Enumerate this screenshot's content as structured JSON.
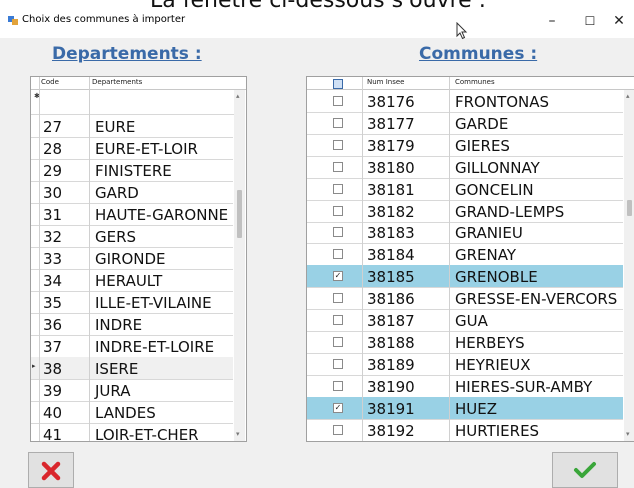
{
  "overlay_text": "La fenêtre ci-dessous s'ouvre :",
  "window": {
    "title": "Choix des communes à importer",
    "minimize": "–",
    "maximize": "☐",
    "close": "✕"
  },
  "departements": {
    "section_title": "Departements :",
    "headers": {
      "code": "Code",
      "name": "Departements"
    },
    "rows": [
      {
        "code": "27",
        "name": "EURE"
      },
      {
        "code": "28",
        "name": "EURE-ET-LOIR"
      },
      {
        "code": "29",
        "name": "FINISTERE"
      },
      {
        "code": "30",
        "name": "GARD"
      },
      {
        "code": "31",
        "name": "HAUTE-GARONNE"
      },
      {
        "code": "32",
        "name": "GERS"
      },
      {
        "code": "33",
        "name": "GIRONDE"
      },
      {
        "code": "34",
        "name": "HERAULT"
      },
      {
        "code": "35",
        "name": "ILLE-ET-VILAINE"
      },
      {
        "code": "36",
        "name": "INDRE"
      },
      {
        "code": "37",
        "name": "INDRE-ET-LOIRE"
      },
      {
        "code": "38",
        "name": "ISERE"
      },
      {
        "code": "39",
        "name": "JURA"
      },
      {
        "code": "40",
        "name": "LANDES"
      },
      {
        "code": "41",
        "name": "LOIR-ET-CHER"
      }
    ]
  },
  "communes": {
    "section_title": "Communes :",
    "headers": {
      "insee": "Num Insee",
      "name": "Communes"
    },
    "rows": [
      {
        "insee": "38176",
        "name": "FRONTONAS",
        "checked": false
      },
      {
        "insee": "38177",
        "name": "GARDE",
        "checked": false
      },
      {
        "insee": "38179",
        "name": "GIERES",
        "checked": false
      },
      {
        "insee": "38180",
        "name": "GILLONNAY",
        "checked": false
      },
      {
        "insee": "38181",
        "name": "GONCELIN",
        "checked": false
      },
      {
        "insee": "38182",
        "name": "GRAND-LEMPS",
        "checked": false
      },
      {
        "insee": "38183",
        "name": "GRANIEU",
        "checked": false
      },
      {
        "insee": "38184",
        "name": "GRENAY",
        "checked": false
      },
      {
        "insee": "38185",
        "name": "GRENOBLE",
        "checked": true
      },
      {
        "insee": "38186",
        "name": "GRESSE-EN-VERCORS",
        "checked": false
      },
      {
        "insee": "38187",
        "name": "GUA",
        "checked": false
      },
      {
        "insee": "38188",
        "name": "HERBEYS",
        "checked": false
      },
      {
        "insee": "38189",
        "name": "HEYRIEUX",
        "checked": false
      },
      {
        "insee": "38190",
        "name": "HIERES-SUR-AMBY",
        "checked": false
      },
      {
        "insee": "38191",
        "name": "HUEZ",
        "checked": true
      },
      {
        "insee": "38192",
        "name": "HURTIERES",
        "checked": false
      }
    ]
  },
  "icons": {
    "cancel": "red-x-icon",
    "confirm": "green-check-icon"
  },
  "colors": {
    "section_title": "#3a6aa8",
    "selected_row": "#99d1e5",
    "cancel_red": "#d9262c",
    "confirm_green": "#3aa63a"
  }
}
